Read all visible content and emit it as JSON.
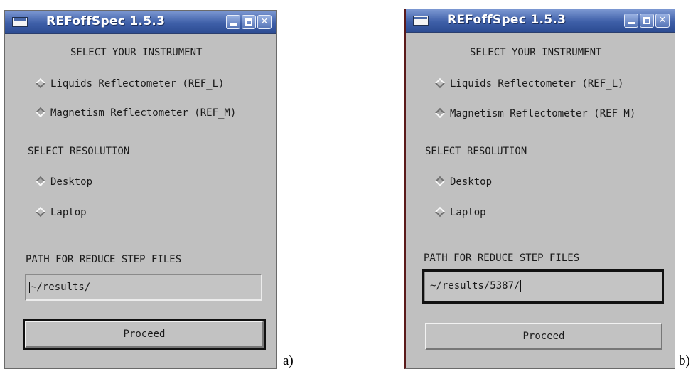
{
  "panels": [
    {
      "title": "REFoffSpec 1.5.3",
      "heading_instrument": "SELECT YOUR INSTRUMENT",
      "instruments": [
        {
          "label": "Liquids Reflectometer (REF_L)",
          "selected": false
        },
        {
          "label": "Magnetism Reflectometer (REF_M)",
          "selected": true
        }
      ],
      "heading_resolution": "SELECT RESOLUTION",
      "resolutions": [
        {
          "label": "Desktop",
          "selected": true
        },
        {
          "label": "Laptop",
          "selected": false
        }
      ],
      "heading_path": "PATH FOR REDUCE STEP FILES",
      "path_value": "~/results/",
      "proceed_label": "Proceed",
      "focus": "proceed",
      "caption": "a)"
    },
    {
      "title": "REFoffSpec 1.5.3",
      "heading_instrument": "SELECT YOUR INSTRUMENT",
      "instruments": [
        {
          "label": "Liquids Reflectometer (REF_L)",
          "selected": false
        },
        {
          "label": "Magnetism Reflectometer (REF_M)",
          "selected": true
        }
      ],
      "heading_resolution": "SELECT RESOLUTION",
      "resolutions": [
        {
          "label": "Desktop",
          "selected": true
        },
        {
          "label": "Laptop",
          "selected": false
        }
      ],
      "heading_path": "PATH FOR REDUCE STEP FILES",
      "path_value": "~/results/5387/",
      "proceed_label": "Proceed",
      "focus": "path",
      "caption": "b)"
    }
  ],
  "window_buttons": {
    "minimize": "minimize-icon",
    "maximize": "maximize-icon",
    "close": "close-icon"
  }
}
